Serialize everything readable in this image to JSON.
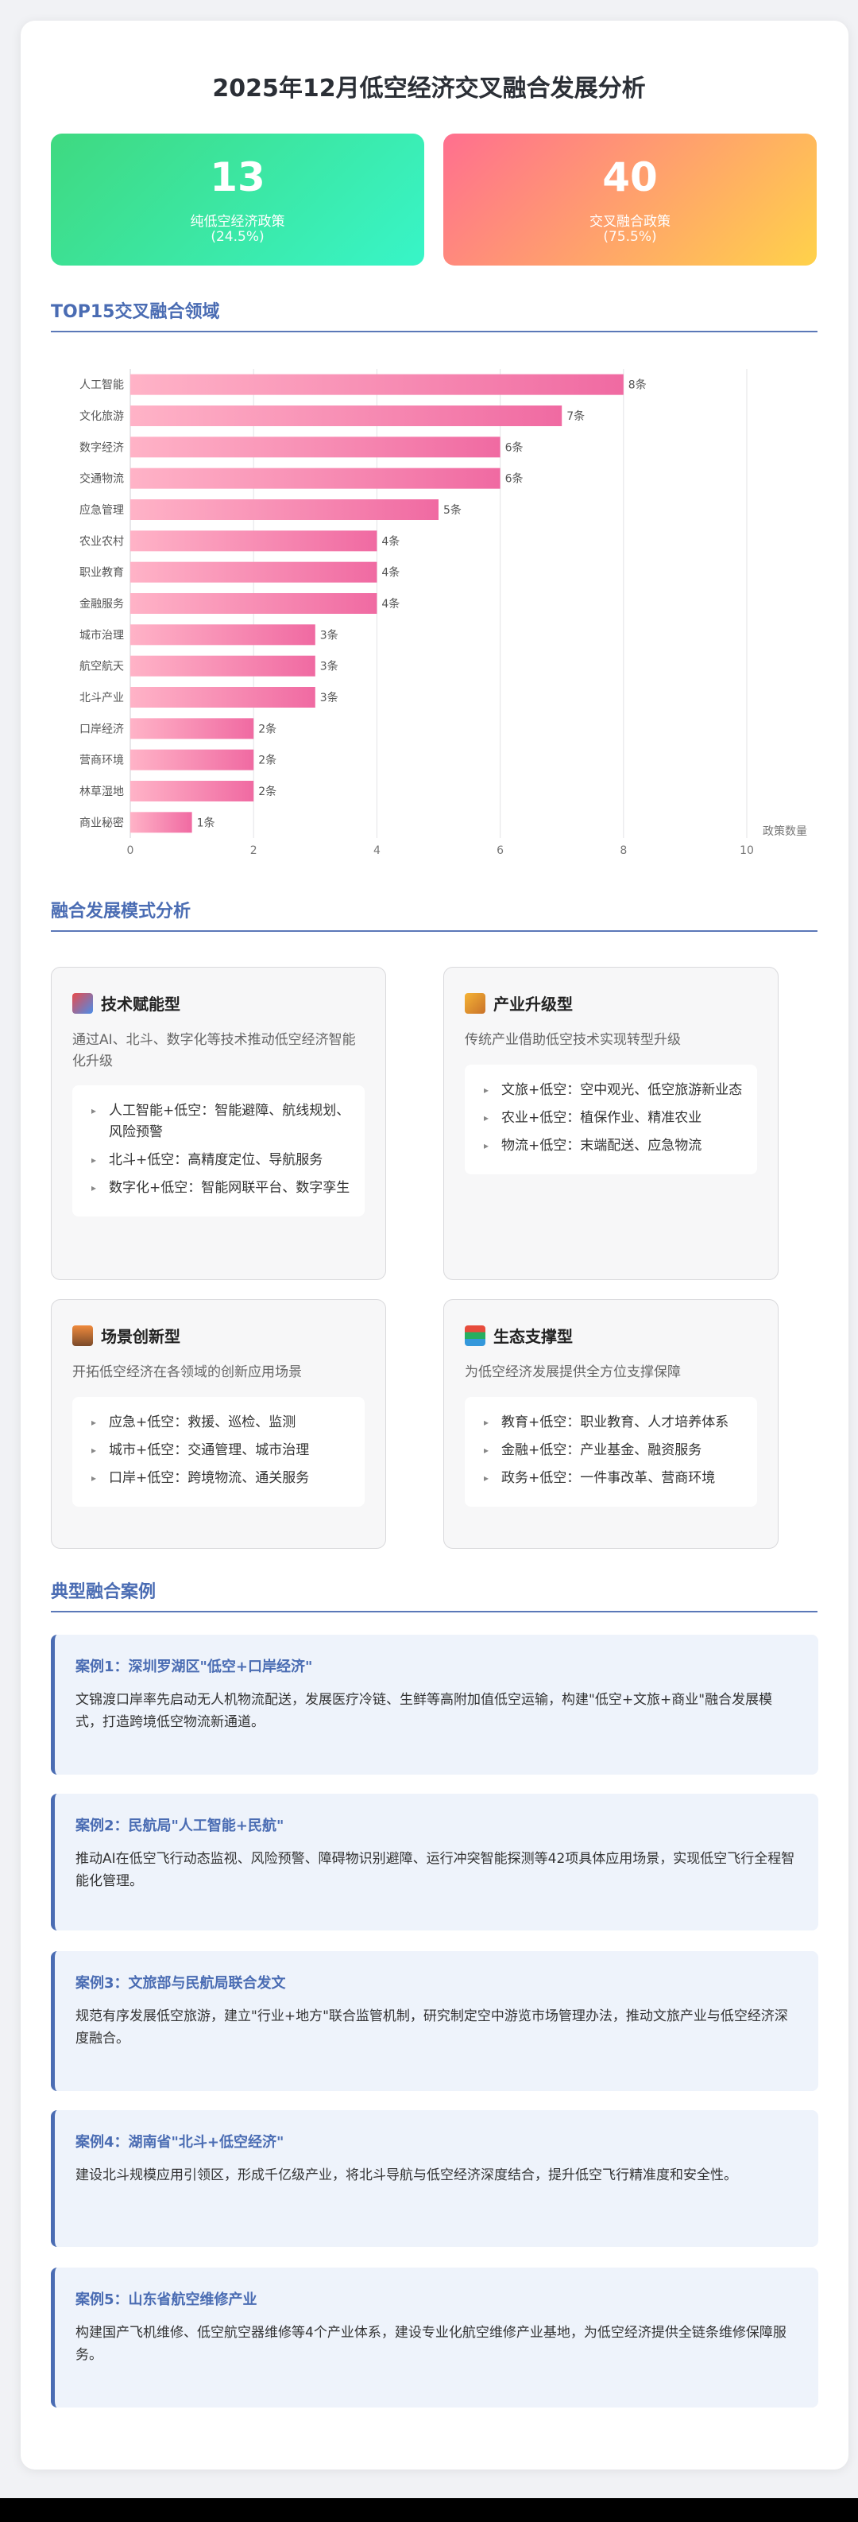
{
  "page": {
    "title": "2025年12月低空经济交叉融合发展分析"
  },
  "stats": [
    {
      "value": "13",
      "label": "纯低空经济政策",
      "percent": "(24.5%)",
      "color_from": "#3fd980",
      "color_to": "#38f5c8"
    },
    {
      "value": "40",
      "label": "交叉融合政策",
      "percent": "(75.5%)",
      "color_from": "#ff6f8f",
      "color_to": "#ffd24a"
    }
  ],
  "sections": {
    "top15": "TOP15交叉融合领域",
    "modes": "融合发展模式分析",
    "cases": "典型融合案例"
  },
  "chart_data": {
    "type": "bar",
    "orientation": "horizontal",
    "title": "",
    "xlabel": "政策数量",
    "ylabel": "",
    "xlim": [
      0,
      10
    ],
    "xticks": [
      0,
      2,
      4,
      6,
      8,
      10
    ],
    "grid": true,
    "value_suffix": "条",
    "bar_color_from": "#ffb3c7",
    "bar_color_to": "#f06aa2",
    "categories": [
      "人工智能",
      "文化旅游",
      "数字经济",
      "交通物流",
      "应急管理",
      "农业农村",
      "职业教育",
      "金融服务",
      "城市治理",
      "航空航天",
      "北斗产业",
      "口岸经济",
      "营商环境",
      "林草湿地",
      "商业秘密"
    ],
    "values": [
      8,
      7,
      6,
      6,
      5,
      4,
      4,
      4,
      3,
      3,
      3,
      2,
      2,
      2,
      1
    ]
  },
  "modes": [
    {
      "icon": "rocket-icon",
      "title": "技术赋能型",
      "desc": "通过AI、北斗、数字化等技术推动低空经济智能化升级",
      "items": [
        "人工智能+低空：智能避障、航线规划、风险预警",
        "北斗+低空：高精度定位、导航服务",
        "数字化+低空：智能网联平台、数字孪生"
      ]
    },
    {
      "icon": "factory-icon",
      "title": "产业升级型",
      "desc": "传统产业借助低空技术实现转型升级",
      "items": [
        "文旅+低空：空中观光、低空旅游新业态",
        "农业+低空：植保作业、精准农业",
        "物流+低空：末端配送、应急物流"
      ]
    },
    {
      "icon": "scene-icon",
      "title": "场景创新型",
      "desc": "开拓低空经济在各领域的创新应用场景",
      "items": [
        "应急+低空：救援、巡检、监测",
        "城市+低空：交通管理、城市治理",
        "口岸+低空：跨境物流、通关服务"
      ]
    },
    {
      "icon": "books-icon",
      "title": "生态支撑型",
      "desc": "为低空经济发展提供全方位支撑保障",
      "items": [
        "教育+低空：职业教育、人才培养体系",
        "金融+低空：产业基金、融资服务",
        "政务+低空：一件事改革、营商环境"
      ]
    }
  ],
  "cases": [
    {
      "title": "案例1：深圳罗湖区\"低空+口岸经济\"",
      "text": "文锦渡口岸率先启动无人机物流配送，发展医疗冷链、生鲜等高附加值低空运输，构建\"低空+文旅+商业\"融合发展模式，打造跨境低空物流新通道。"
    },
    {
      "title": "案例2：民航局\"人工智能+民航\"",
      "text": "推动AI在低空飞行动态监视、风险预警、障碍物识别避障、运行冲突智能探测等42项具体应用场景，实现低空飞行全程智能化管理。"
    },
    {
      "title": "案例3：文旅部与民航局联合发文",
      "text": "规范有序发展低空旅游，建立\"行业+地方\"联合监管机制，研究制定空中游览市场管理办法，推动文旅产业与低空经济深度融合。"
    },
    {
      "title": "案例4：湖南省\"北斗+低空经济\"",
      "text": "建设北斗规模应用引领区，形成千亿级产业，将北斗导航与低空经济深度结合，提升低空飞行精准度和安全性。"
    },
    {
      "title": "案例5：山东省航空维修产业",
      "text": "构建国产飞机维修、低空航空器维修等4个产业体系，建设专业化航空维修产业基地，为低空经济提供全链条维修保障服务。"
    }
  ]
}
